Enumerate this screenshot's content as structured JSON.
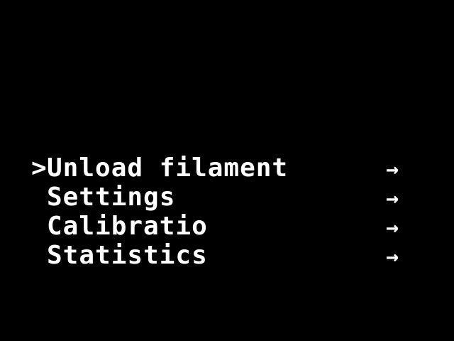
{
  "theme": {
    "background": "#000000",
    "foreground": "#ffffff"
  },
  "menu": {
    "cursor": ">",
    "items": [
      {
        "label": "Unload filament",
        "arrow": "→",
        "selected": true
      },
      {
        "label": "Settings",
        "arrow": "→",
        "selected": false
      },
      {
        "label": "Calibratio",
        "arrow": "→",
        "selected": false
      },
      {
        "label": "Statistics",
        "arrow": "→",
        "selected": false
      }
    ]
  }
}
